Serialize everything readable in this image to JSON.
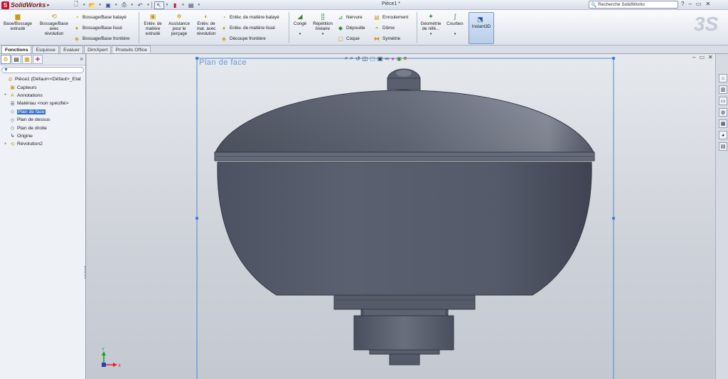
{
  "app": {
    "name": "SolidWorks",
    "document_title": "Pièce1 *",
    "search_placeholder": "Recherche SolidWorks",
    "help_glyph": "?",
    "win_ctrls": [
      "–",
      "▭",
      "✕"
    ]
  },
  "qat": {
    "icons": [
      "new-document-icon",
      "open-icon",
      "save-icon",
      "print-icon",
      "undo-icon",
      "select-icon",
      "rebuild-icon",
      "options-icon"
    ]
  },
  "ribbon": {
    "extrude_boss": "Base/Bossage\nextrudé",
    "revolve_boss": "Bossage/Base\navec\nrévolution",
    "swept_boss": "Bossage/Base balayé",
    "lofted_boss": "Bossage/Base lissé",
    "boundary_boss": "Bossage/Base frontière",
    "extrude_cut": "Enlèv. de\nmatière\nextrudé",
    "hole_wizard": "Assistance\npour le\nperçage",
    "revolve_cut": "Enlèv. de\nmat. avec\nrévolution",
    "swept_cut": "Enlèv. de matière balayé",
    "lofted_cut": "Enlèv. de matière lissé",
    "boundary_cut": "Découpe frontière",
    "fillet": "Congé",
    "linear_pattern": "Répétition\nlinéaire",
    "rib": "Nervure",
    "draft": "Dépouille",
    "shell": "Coque",
    "wrap": "Enroulement",
    "dome": "Dôme",
    "mirror": "Symétrie",
    "ref_geometry": "Géométrie\nde réfé...",
    "curves": "Courbes",
    "instant3d": "Instant3D"
  },
  "tabs": [
    "Fonctions",
    "Esquisse",
    "Evaluer",
    "DimXpert",
    "Produits Office"
  ],
  "tabs_active": "Fonctions",
  "panel": {
    "more": "»",
    "filter_glyph": "▼",
    "tree": [
      {
        "label": "Pièce1  (Défaut<<Défaut>_Etat",
        "icon": "part-icon",
        "exp": "",
        "indent": 0
      },
      {
        "label": "Capteurs",
        "icon": "sensors-icon",
        "exp": "",
        "indent": 1
      },
      {
        "label": "Annotations",
        "icon": "annotations-icon",
        "exp": "+",
        "indent": 1
      },
      {
        "label": "Matériau <non spécifié>",
        "icon": "material-icon",
        "exp": "",
        "indent": 1
      },
      {
        "label": "Plan de face",
        "icon": "plane-icon",
        "exp": "",
        "indent": 1,
        "selected": true
      },
      {
        "label": "Plan de dessus",
        "icon": "plane-icon",
        "exp": "",
        "indent": 1
      },
      {
        "label": "Plan de droite",
        "icon": "plane-icon",
        "exp": "",
        "indent": 1
      },
      {
        "label": "Origine",
        "icon": "origin-icon",
        "exp": "",
        "indent": 1
      },
      {
        "label": "Révolution2",
        "icon": "revolve-feature-icon",
        "exp": "+",
        "indent": 1
      }
    ]
  },
  "graphics": {
    "plane_label": "Plan de face",
    "triad": {
      "x_label": "X",
      "y_label": "Y"
    }
  },
  "colors": {
    "model": "#5d6271",
    "plane_outline": "#4f87d6",
    "selection": "#3470c8"
  }
}
